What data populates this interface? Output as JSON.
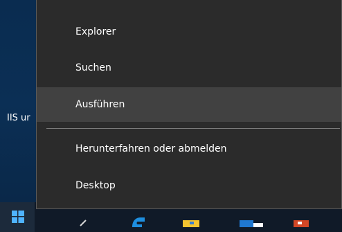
{
  "desktop": {
    "label": "IIS ur"
  },
  "context_menu": {
    "items": [
      {
        "label": "Explorer"
      },
      {
        "label": "Suchen"
      },
      {
        "label": "Ausführen"
      },
      {
        "label": "Herunterfahren oder abmelden"
      },
      {
        "label": "Desktop"
      }
    ],
    "highlighted_item": "Ausführen"
  },
  "taskbar": {
    "icons": [
      "windows-start-icon",
      "search-icon",
      "edge-icon",
      "file-explorer-icon",
      "store-icon",
      "outlook-icon",
      "powerpoint-icon"
    ]
  }
}
